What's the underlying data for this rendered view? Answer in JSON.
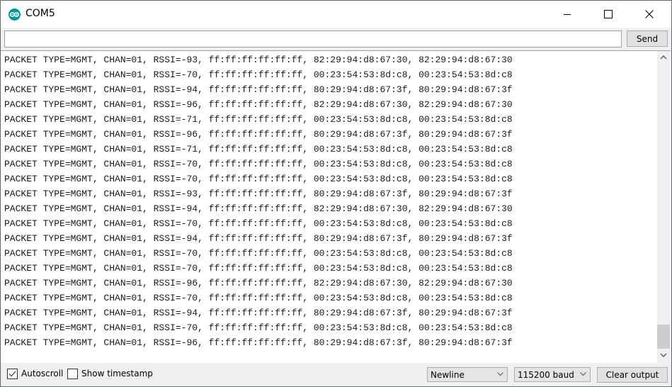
{
  "window": {
    "title": "COM5",
    "app_icon": "arduino-logo-icon",
    "controls": [
      "minimize-icon",
      "maximize-icon",
      "close-icon"
    ]
  },
  "send_bar": {
    "input_value": "",
    "input_placeholder": "",
    "send_label": "Send"
  },
  "output": {
    "lines": [
      "PACKET TYPE=MGMT, CHAN=01, RSSI=-93, ff:ff:ff:ff:ff:ff, 82:29:94:d8:67:30, 82:29:94:d8:67:30",
      "PACKET TYPE=MGMT, CHAN=01, RSSI=-70, ff:ff:ff:ff:ff:ff, 00:23:54:53:8d:c8, 00:23:54:53:8d:c8",
      "PACKET TYPE=MGMT, CHAN=01, RSSI=-94, ff:ff:ff:ff:ff:ff, 80:29:94:d8:67:3f, 80:29:94:d8:67:3f",
      "PACKET TYPE=MGMT, CHAN=01, RSSI=-96, ff:ff:ff:ff:ff:ff, 82:29:94:d8:67:30, 82:29:94:d8:67:30",
      "PACKET TYPE=MGMT, CHAN=01, RSSI=-71, ff:ff:ff:ff:ff:ff, 00:23:54:53:8d:c8, 00:23:54:53:8d:c8",
      "PACKET TYPE=MGMT, CHAN=01, RSSI=-96, ff:ff:ff:ff:ff:ff, 80:29:94:d8:67:3f, 80:29:94:d8:67:3f",
      "PACKET TYPE=MGMT, CHAN=01, RSSI=-71, ff:ff:ff:ff:ff:ff, 00:23:54:53:8d:c8, 00:23:54:53:8d:c8",
      "PACKET TYPE=MGMT, CHAN=01, RSSI=-70, ff:ff:ff:ff:ff:ff, 00:23:54:53:8d:c8, 00:23:54:53:8d:c8",
      "PACKET TYPE=MGMT, CHAN=01, RSSI=-70, ff:ff:ff:ff:ff:ff, 00:23:54:53:8d:c8, 00:23:54:53:8d:c8",
      "PACKET TYPE=MGMT, CHAN=01, RSSI=-93, ff:ff:ff:ff:ff:ff, 80:29:94:d8:67:3f, 80:29:94:d8:67:3f",
      "PACKET TYPE=MGMT, CHAN=01, RSSI=-94, ff:ff:ff:ff:ff:ff, 82:29:94:d8:67:30, 82:29:94:d8:67:30",
      "PACKET TYPE=MGMT, CHAN=01, RSSI=-70, ff:ff:ff:ff:ff:ff, 00:23:54:53:8d:c8, 00:23:54:53:8d:c8",
      "PACKET TYPE=MGMT, CHAN=01, RSSI=-94, ff:ff:ff:ff:ff:ff, 80:29:94:d8:67:3f, 80:29:94:d8:67:3f",
      "PACKET TYPE=MGMT, CHAN=01, RSSI=-70, ff:ff:ff:ff:ff:ff, 00:23:54:53:8d:c8, 00:23:54:53:8d:c8",
      "PACKET TYPE=MGMT, CHAN=01, RSSI=-70, ff:ff:ff:ff:ff:ff, 00:23:54:53:8d:c8, 00:23:54:53:8d:c8",
      "PACKET TYPE=MGMT, CHAN=01, RSSI=-96, ff:ff:ff:ff:ff:ff, 82:29:94:d8:67:30, 82:29:94:d8:67:30",
      "PACKET TYPE=MGMT, CHAN=01, RSSI=-70, ff:ff:ff:ff:ff:ff, 00:23:54:53:8d:c8, 00:23:54:53:8d:c8",
      "PACKET TYPE=MGMT, CHAN=01, RSSI=-94, ff:ff:ff:ff:ff:ff, 80:29:94:d8:67:3f, 80:29:94:d8:67:3f",
      "PACKET TYPE=MGMT, CHAN=01, RSSI=-70, ff:ff:ff:ff:ff:ff, 00:23:54:53:8d:c8, 00:23:54:53:8d:c8",
      "PACKET TYPE=MGMT, CHAN=01, RSSI=-96, ff:ff:ff:ff:ff:ff, 80:29:94:d8:67:3f, 80:29:94:d8:67:3f"
    ],
    "scroll_position_fraction": 0.95
  },
  "bottom_bar": {
    "autoscroll_label": "Autoscroll",
    "autoscroll_checked": true,
    "timestamp_label": "Show timestamp",
    "timestamp_checked": false,
    "line_ending_selected": "Newline",
    "baud_selected": "115200 baud",
    "clear_label": "Clear output"
  },
  "colors": {
    "brand": "#00979c",
    "chrome": "#f0f0f0",
    "button": "#e1e1e1"
  }
}
